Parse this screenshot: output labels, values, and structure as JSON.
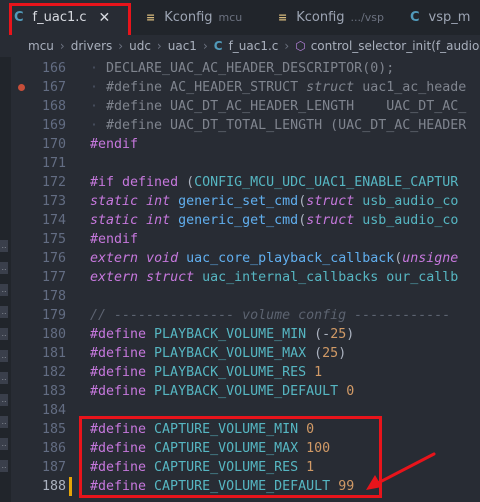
{
  "tabs": [
    {
      "icon": "C",
      "name": "f_uac1.c",
      "desc": "",
      "close": "✕",
      "active": true
    },
    {
      "icon": "≡",
      "name": "Kconfig",
      "desc": "mcu",
      "close": "",
      "active": false
    },
    {
      "icon": "≡",
      "name": "Kconfig",
      "desc": ".../vsp",
      "close": "",
      "active": false
    },
    {
      "icon": "C",
      "name": "vsp_m",
      "desc": "",
      "close": "",
      "active": false
    }
  ],
  "breadcrumb": {
    "parts": [
      "mcu",
      "drivers",
      "udc",
      "uac1"
    ],
    "file_icon": "C",
    "file": "f_uac1.c",
    "symbol_icon": "⬡",
    "symbol": "control_selector_init(f_audio"
  },
  "left_markers": [
    "..",
    "..",
    "..",
    "..",
    "..",
    "..",
    "..",
    "..",
    "..",
    "..",
    ".."
  ],
  "lines": [
    {
      "n": "166",
      "segs": [
        {
          "t": "· ",
          "c": "ws"
        },
        {
          "t": "DECLARE_UAC_AC_HEADER_DESCRIPTOR(0);",
          "c": "dim"
        }
      ]
    },
    {
      "n": "167",
      "bp": true,
      "segs": [
        {
          "t": "· ",
          "c": "ws"
        },
        {
          "t": "#define AC_HEADER_STRUCT ",
          "c": "dim"
        },
        {
          "t": "struct",
          "c": "dim it"
        },
        {
          "t": " uac1_ac_heade",
          "c": "dim"
        }
      ]
    },
    {
      "n": "168",
      "segs": [
        {
          "t": "· ",
          "c": "ws"
        },
        {
          "t": "#define UAC_DT_AC_HEADER_LENGTH    UAC_DT_AC_",
          "c": "dim"
        }
      ]
    },
    {
      "n": "169",
      "segs": [
        {
          "t": "· ",
          "c": "ws"
        },
        {
          "t": "#define UAC_DT_TOTAL_LENGTH (UAC_DT_AC_HEADER",
          "c": "dim"
        }
      ]
    },
    {
      "n": "170",
      "segs": [
        {
          "t": "#endif",
          "c": "kw"
        }
      ]
    },
    {
      "n": "171",
      "segs": []
    },
    {
      "n": "172",
      "segs": [
        {
          "t": "#if ",
          "c": "kw"
        },
        {
          "t": "defined ",
          "c": "kw"
        },
        {
          "t": "(",
          "c": ""
        },
        {
          "t": "CONFIG_MCU_UDC_UAC1_ENABLE_CAPTUR",
          "c": "mac"
        }
      ]
    },
    {
      "n": "173",
      "segs": [
        {
          "t": "static",
          "c": "kw it"
        },
        {
          "t": " ",
          "c": ""
        },
        {
          "t": "int",
          "c": "kw it"
        },
        {
          "t": " ",
          "c": ""
        },
        {
          "t": "generic_set_cmd",
          "c": "fn"
        },
        {
          "t": "(",
          "c": ""
        },
        {
          "t": "struct",
          "c": "kw it"
        },
        {
          "t": " usb_audio_co",
          "c": "mac"
        }
      ]
    },
    {
      "n": "174",
      "segs": [
        {
          "t": "static",
          "c": "kw it"
        },
        {
          "t": " ",
          "c": ""
        },
        {
          "t": "int",
          "c": "kw it"
        },
        {
          "t": " ",
          "c": ""
        },
        {
          "t": "generic_get_cmd",
          "c": "fn"
        },
        {
          "t": "(",
          "c": ""
        },
        {
          "t": "struct",
          "c": "kw it"
        },
        {
          "t": " usb_audio_co",
          "c": "mac"
        }
      ]
    },
    {
      "n": "175",
      "segs": [
        {
          "t": "#endif",
          "c": "kw"
        }
      ]
    },
    {
      "n": "176",
      "segs": [
        {
          "t": "extern",
          "c": "kw it"
        },
        {
          "t": " ",
          "c": ""
        },
        {
          "t": "void",
          "c": "kw it"
        },
        {
          "t": " ",
          "c": ""
        },
        {
          "t": "uac_core_playback_callback",
          "c": "fn"
        },
        {
          "t": "(",
          "c": ""
        },
        {
          "t": "unsigne",
          "c": "kw it"
        }
      ]
    },
    {
      "n": "177",
      "segs": [
        {
          "t": "extern",
          "c": "kw it"
        },
        {
          "t": " ",
          "c": ""
        },
        {
          "t": "struct",
          "c": "kw it"
        },
        {
          "t": " uac_internal_callbacks our_callb",
          "c": "mac"
        }
      ]
    },
    {
      "n": "178",
      "segs": []
    },
    {
      "n": "179",
      "segs": [
        {
          "t": "// --------------- volume config ------------",
          "c": "cm"
        }
      ]
    },
    {
      "n": "180",
      "segs": [
        {
          "t": "#define ",
          "c": "kw"
        },
        {
          "t": "PLAYBACK_VOLUME_MIN",
          "c": "mac"
        },
        {
          "t": " (-",
          "c": ""
        },
        {
          "t": "25",
          "c": "num"
        },
        {
          "t": ")",
          "c": ""
        }
      ]
    },
    {
      "n": "181",
      "segs": [
        {
          "t": "#define ",
          "c": "kw"
        },
        {
          "t": "PLAYBACK_VOLUME_MAX",
          "c": "mac"
        },
        {
          "t": " (",
          "c": ""
        },
        {
          "t": "25",
          "c": "num"
        },
        {
          "t": ")",
          "c": ""
        }
      ]
    },
    {
      "n": "182",
      "segs": [
        {
          "t": "#define ",
          "c": "kw"
        },
        {
          "t": "PLAYBACK_VOLUME_RES",
          "c": "mac"
        },
        {
          "t": " ",
          "c": ""
        },
        {
          "t": "1",
          "c": "num"
        }
      ]
    },
    {
      "n": "183",
      "segs": [
        {
          "t": "#define ",
          "c": "kw"
        },
        {
          "t": "PLAYBACK_VOLUME_DEFAULT",
          "c": "mac"
        },
        {
          "t": " ",
          "c": ""
        },
        {
          "t": "0",
          "c": "num"
        }
      ]
    },
    {
      "n": "184",
      "segs": []
    },
    {
      "n": "185",
      "segs": [
        {
          "t": "#define ",
          "c": "kw"
        },
        {
          "t": "CAPTURE_VOLUME_MIN",
          "c": "mac"
        },
        {
          "t": " ",
          "c": ""
        },
        {
          "t": "0",
          "c": "num"
        }
      ]
    },
    {
      "n": "186",
      "segs": [
        {
          "t": "#define ",
          "c": "kw"
        },
        {
          "t": "CAPTURE_VOLUME_MAX",
          "c": "mac"
        },
        {
          "t": " ",
          "c": ""
        },
        {
          "t": "100",
          "c": "num"
        }
      ]
    },
    {
      "n": "187",
      "segs": [
        {
          "t": "#define ",
          "c": "kw"
        },
        {
          "t": "CAPTURE_VOLUME_RES",
          "c": "mac"
        },
        {
          "t": " ",
          "c": ""
        },
        {
          "t": "1",
          "c": "num"
        }
      ]
    },
    {
      "n": "188",
      "mod": true,
      "cur": true,
      "segs": [
        {
          "t": "#define ",
          "c": "kw"
        },
        {
          "t": "CAPTURE_VOLUME_DEFAULT",
          "c": "mac"
        },
        {
          "t": " ",
          "c": ""
        },
        {
          "t": "99",
          "c": "num"
        }
      ]
    }
  ],
  "colors": {
    "highlight": "#e8141b",
    "background": "#282c34",
    "keyword": "#c678dd",
    "macro": "#56b6c2",
    "number": "#d19a66",
    "function": "#61afef"
  }
}
